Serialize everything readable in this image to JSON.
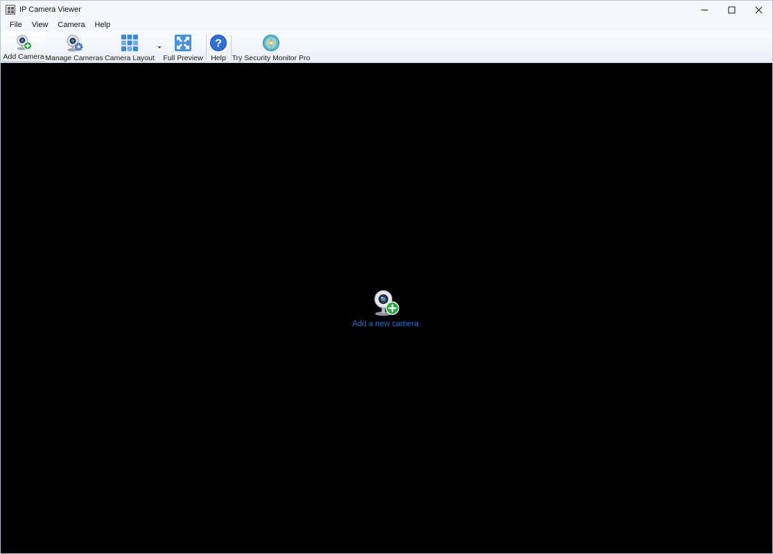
{
  "window": {
    "title": "IP Camera Viewer"
  },
  "menu": {
    "items": [
      "File",
      "View",
      "Camera",
      "Help"
    ]
  },
  "toolbar": {
    "add_camera": "Add Camera",
    "manage_cameras": "Manage Cameras",
    "camera_layout": "Camera Layout",
    "full_preview": "Full Preview",
    "help": "Help",
    "try_pro": "Try Security Monitor Pro"
  },
  "viewport": {
    "empty_link": "Add a new camera"
  },
  "colors": {
    "viewport_bg": "#000000",
    "link": "#1e6fd0",
    "plus_green": "#27a844",
    "help_blue": "#2f6fd6"
  },
  "icons": {
    "add_camera": "webcam-plus-icon",
    "manage_cameras": "webcam-gear-icon",
    "camera_layout": "grid-layout-icon",
    "full_preview": "expand-arrows-icon",
    "help": "question-icon",
    "try_pro": "compass-icon"
  }
}
